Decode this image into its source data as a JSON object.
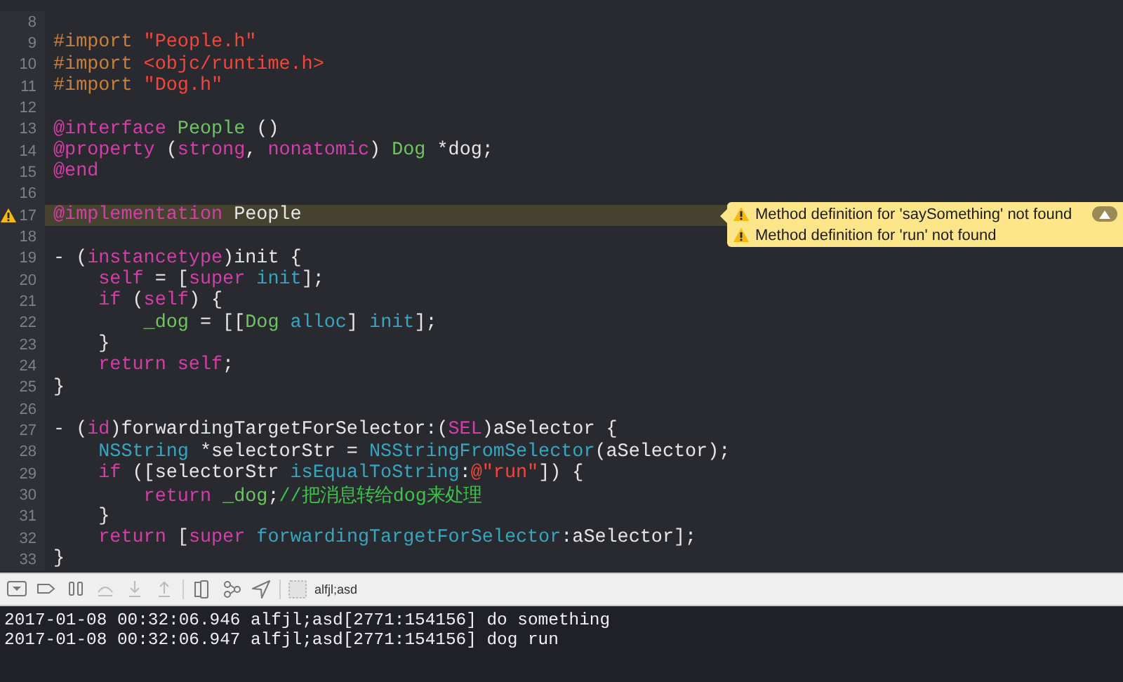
{
  "editor": {
    "lines": [
      {
        "number": "8",
        "warning": false
      },
      {
        "number": "9",
        "warning": false,
        "tokens": [
          {
            "kind": "preproc",
            "text": "#import "
          },
          {
            "kind": "string",
            "text": "\"People.h\""
          }
        ]
      },
      {
        "number": "10",
        "warning": false,
        "tokens": [
          {
            "kind": "preproc",
            "text": "#import "
          },
          {
            "kind": "string",
            "text": "<objc/runtime.h>"
          }
        ]
      },
      {
        "number": "11",
        "warning": false,
        "tokens": [
          {
            "kind": "preproc",
            "text": "#import "
          },
          {
            "kind": "string",
            "text": "\"Dog.h\""
          }
        ]
      },
      {
        "number": "12",
        "warning": false
      },
      {
        "number": "13",
        "warning": false,
        "tokens": [
          {
            "kind": "keyword",
            "text": "@interface "
          },
          {
            "kind": "type",
            "text": "People"
          },
          {
            "kind": "plain",
            "text": " ()"
          }
        ]
      },
      {
        "number": "14",
        "warning": false,
        "tokens": [
          {
            "kind": "keyword",
            "text": "@property"
          },
          {
            "kind": "plain",
            "text": " ("
          },
          {
            "kind": "keyword",
            "text": "strong"
          },
          {
            "kind": "plain",
            "text": ", "
          },
          {
            "kind": "keyword",
            "text": "nonatomic"
          },
          {
            "kind": "plain",
            "text": ") "
          },
          {
            "kind": "type",
            "text": "Dog"
          },
          {
            "kind": "plain",
            "text": " *dog;"
          }
        ]
      },
      {
        "number": "15",
        "warning": false,
        "tokens": [
          {
            "kind": "keyword",
            "text": "@end"
          }
        ]
      },
      {
        "number": "16",
        "warning": false
      },
      {
        "number": "17",
        "warning": true,
        "tokens": [
          {
            "kind": "keyword",
            "text": "@implementation "
          },
          {
            "kind": "plain",
            "text": "People"
          }
        ]
      },
      {
        "number": "18",
        "warning": false
      },
      {
        "number": "19",
        "warning": false,
        "tokens": [
          {
            "kind": "plain",
            "text": "- ("
          },
          {
            "kind": "keyword",
            "text": "instancetype"
          },
          {
            "kind": "plain",
            "text": ")init {"
          }
        ]
      },
      {
        "number": "20",
        "warning": false,
        "tokens": [
          {
            "kind": "keyword",
            "text": "    self"
          },
          {
            "kind": "plain",
            "text": " = ["
          },
          {
            "kind": "keyword",
            "text": "super "
          },
          {
            "kind": "method",
            "text": "init"
          },
          {
            "kind": "plain",
            "text": "];"
          }
        ]
      },
      {
        "number": "21",
        "warning": false,
        "tokens": [
          {
            "kind": "keyword",
            "text": "    if"
          },
          {
            "kind": "plain",
            "text": " ("
          },
          {
            "kind": "keyword",
            "text": "self"
          },
          {
            "kind": "plain",
            "text": ") {"
          }
        ]
      },
      {
        "number": "22",
        "warning": false,
        "tokens": [
          {
            "kind": "type",
            "text": "        _dog"
          },
          {
            "kind": "plain",
            "text": " = [["
          },
          {
            "kind": "type",
            "text": "Dog "
          },
          {
            "kind": "method",
            "text": "alloc"
          },
          {
            "kind": "plain",
            "text": "] "
          },
          {
            "kind": "method",
            "text": "init"
          },
          {
            "kind": "plain",
            "text": "];"
          }
        ]
      },
      {
        "number": "23",
        "warning": false,
        "tokens": [
          {
            "kind": "plain",
            "text": "    }"
          }
        ]
      },
      {
        "number": "24",
        "warning": false,
        "tokens": [
          {
            "kind": "keyword",
            "text": "    return self"
          },
          {
            "kind": "plain",
            "text": ";"
          }
        ]
      },
      {
        "number": "25",
        "warning": false,
        "tokens": [
          {
            "kind": "plain",
            "text": "}"
          }
        ]
      },
      {
        "number": "26",
        "warning": false
      },
      {
        "number": "27",
        "warning": false,
        "tokens": [
          {
            "kind": "plain",
            "text": "- ("
          },
          {
            "kind": "keyword",
            "text": "id"
          },
          {
            "kind": "plain",
            "text": ")forwardingTargetForSelector:("
          },
          {
            "kind": "keyword",
            "text": "SEL"
          },
          {
            "kind": "plain",
            "text": ")aSelector {"
          }
        ]
      },
      {
        "number": "28",
        "warning": false,
        "tokens": [
          {
            "kind": "method",
            "text": "    NSString"
          },
          {
            "kind": "plain",
            "text": " *selectorStr = "
          },
          {
            "kind": "method",
            "text": "NSStringFromSelector"
          },
          {
            "kind": "plain",
            "text": "(aSelector);"
          }
        ]
      },
      {
        "number": "29",
        "warning": false,
        "tokens": [
          {
            "kind": "keyword",
            "text": "    if"
          },
          {
            "kind": "plain",
            "text": " ([selectorStr "
          },
          {
            "kind": "method",
            "text": "isEqualToString"
          },
          {
            "kind": "plain",
            "text": ":"
          },
          {
            "kind": "string",
            "text": "@\"run\""
          },
          {
            "kind": "plain",
            "text": "]) {"
          }
        ]
      },
      {
        "number": "30",
        "warning": false,
        "tokens": [
          {
            "kind": "keyword",
            "text": "        return "
          },
          {
            "kind": "type",
            "text": "_dog"
          },
          {
            "kind": "plain",
            "text": ";"
          },
          {
            "kind": "comment",
            "text": "//把消息转给dog来处理"
          }
        ]
      },
      {
        "number": "31",
        "warning": false,
        "tokens": [
          {
            "kind": "plain",
            "text": "    }"
          }
        ]
      },
      {
        "number": "32",
        "warning": false,
        "tokens": [
          {
            "kind": "keyword",
            "text": "    return"
          },
          {
            "kind": "plain",
            "text": " ["
          },
          {
            "kind": "keyword",
            "text": "super "
          },
          {
            "kind": "method",
            "text": "forwardingTargetForSelector"
          },
          {
            "kind": "plain",
            "text": ":aSelector];"
          }
        ]
      },
      {
        "number": "33",
        "warning": false,
        "tokens": [
          {
            "kind": "plain",
            "text": "}"
          }
        ]
      }
    ]
  },
  "issues": [
    {
      "text": "Method definition for 'saySomething' not found"
    },
    {
      "text": "Method definition for 'run' not found"
    }
  ],
  "debug_bar": {
    "target": "alfjl;asd"
  },
  "console": {
    "lines": [
      "2017-01-08 00:32:06.946 alfjl;asd[2771:154156] do something",
      "2017-01-08 00:32:06.947 alfjl;asd[2771:154156] dog run"
    ]
  }
}
